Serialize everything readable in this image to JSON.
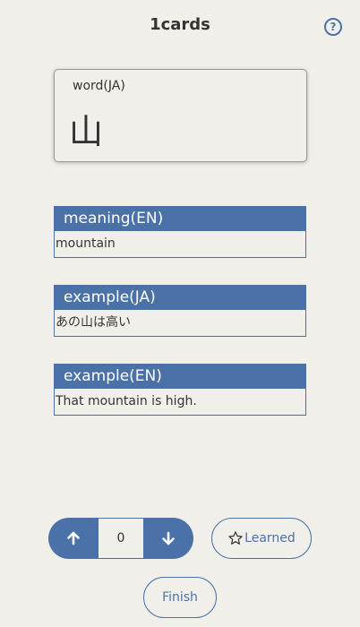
{
  "header": {
    "title": "1cards",
    "help_icon": "?"
  },
  "word_card": {
    "label": "word(JA)",
    "value": "山"
  },
  "sections": [
    {
      "heading": "meaning(EN)",
      "text": "mountain"
    },
    {
      "heading": "example(JA)",
      "text": "あの山は高い"
    },
    {
      "heading": "example(EN)",
      "text": "That mountain is high."
    }
  ],
  "controls": {
    "count": "0",
    "learned_label": "Learned",
    "finish_label": "Finish"
  },
  "colors": {
    "accent": "#4a72a8",
    "background": "#f1efea"
  }
}
